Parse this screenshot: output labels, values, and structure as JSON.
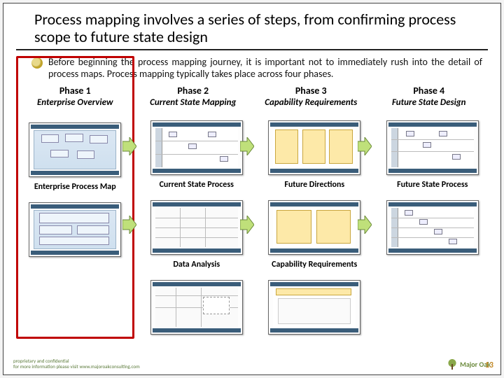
{
  "title": "Process mapping involves a series of steps, from confirming process scope to future state design",
  "intro": "Before beginning the process mapping journey, it is important not to immediately rush into the detail of process maps. Process mapping typically takes place across four phases.",
  "phases": [
    {
      "label": "Phase 1",
      "name": "Enterprise Overview"
    },
    {
      "label": "Phase 2",
      "name": "Current State Mapping"
    },
    {
      "label": "Phase 3",
      "name": "Capability Requirements"
    },
    {
      "label": "Phase 4",
      "name": "Future State Design"
    }
  ],
  "col1": {
    "sub1": "Enterprise Process Map"
  },
  "col2": {
    "sub1": "Current State Process",
    "sub2": "Data Analysis"
  },
  "col3": {
    "sub1": "Future Directions",
    "sub2": "Capability Requirements"
  },
  "col4": {
    "sub1": "Future State Process"
  },
  "footer": {
    "line1": "proprietary and confidential",
    "line2": "for more information please visit www.majoroakconsulting.com",
    "logo": "Major Oak",
    "page": "13"
  },
  "arrow_fill": "#bfe07a",
  "arrow_stroke": "#6b8a3c"
}
